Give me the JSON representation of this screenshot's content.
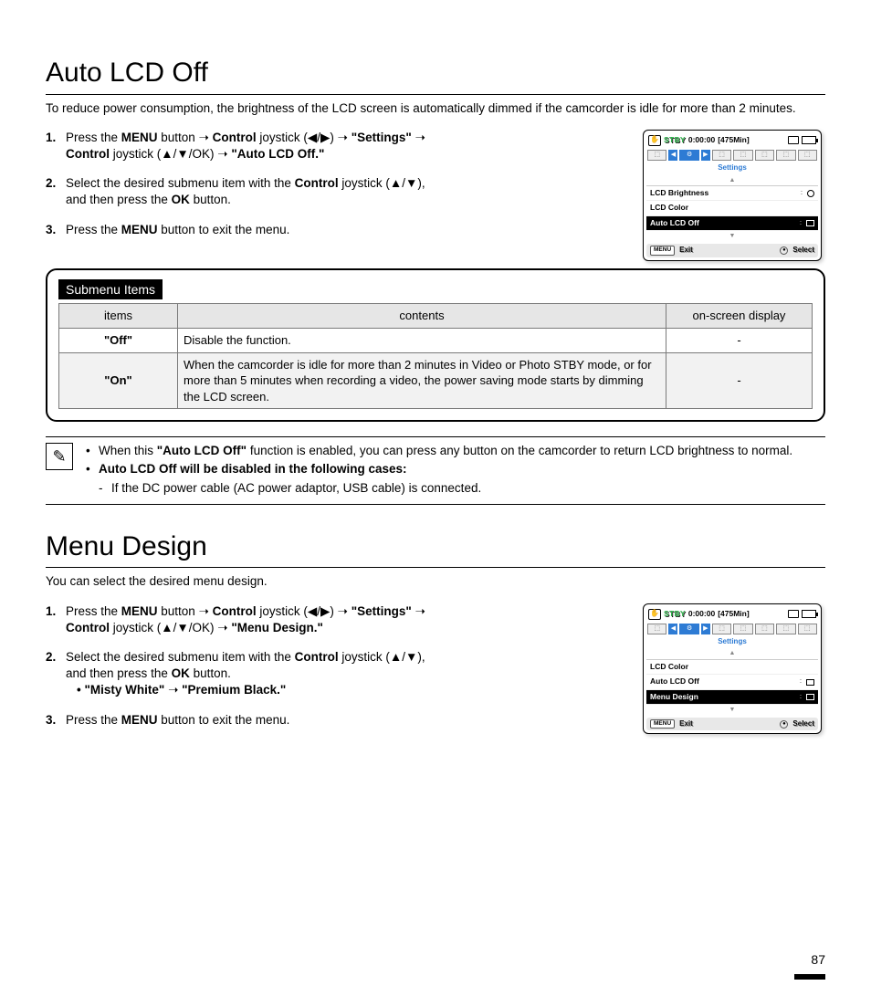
{
  "section1": {
    "title": "Auto LCD Off",
    "intro": "To reduce power consumption, the brightness of the LCD screen is automatically dimmed if the camcorder is idle for more than 2 minutes.",
    "step1_a": "Press the ",
    "menu": "MENU",
    "button_word": " button ",
    "arrow": "➝",
    "control": "Control",
    "joystick_lr": " joystick (◀/▶) ",
    "settings_q": "\"Settings\"",
    "joystick_ud_ok": " joystick (▲/▼/OK) ",
    "target": "\"Auto LCD Off.\"",
    "step2_a": "Select the desired submenu item with the ",
    "joystick_ud": " joystick (▲/▼),",
    "step2_b": "and then press the ",
    "ok": "OK",
    "step2_c": " button.",
    "step3_a": "Press the ",
    "step3_b": " button to exit the menu."
  },
  "table": {
    "label": "Submenu Items",
    "h1": "items",
    "h2": "contents",
    "h3": "on-screen display",
    "r1c1": "\"Off\"",
    "r1c2": "Disable the function.",
    "r1c3": "-",
    "r2c1": "\"On\"",
    "r2c2": "When the camcorder is idle for more than 2 minutes in Video or Photo STBY mode, or for more than 5 minutes when recording a video, the power saving mode starts by dimming the LCD screen.",
    "r2c3": "-"
  },
  "note": {
    "b1a": "When this ",
    "b1q": "\"Auto LCD Off\"",
    "b1b": " function is enabled, you can press any button on the camcorder to return LCD brightness to normal.",
    "b2": "Auto LCD Off will be disabled in the following cases:",
    "d1": "If the DC power cable (AC power adaptor, USB cable) is connected."
  },
  "section2": {
    "title": "Menu Design",
    "intro": "You can select the desired menu design.",
    "target": "\"Menu Design.\"",
    "options_a": "\"Misty White\"",
    "options_b": "\"Premium Black.\""
  },
  "osd": {
    "stby": "STBY",
    "time": "0:00:00",
    "remain": "[475Min]",
    "settings": "Settings",
    "row_brightness": "LCD Brightness",
    "row_color": "LCD Color",
    "row_auto": "Auto LCD Off",
    "row_design": "Menu Design",
    "menu_btn": "MENU",
    "exit": "Exit",
    "select": "Select"
  },
  "page": "87"
}
